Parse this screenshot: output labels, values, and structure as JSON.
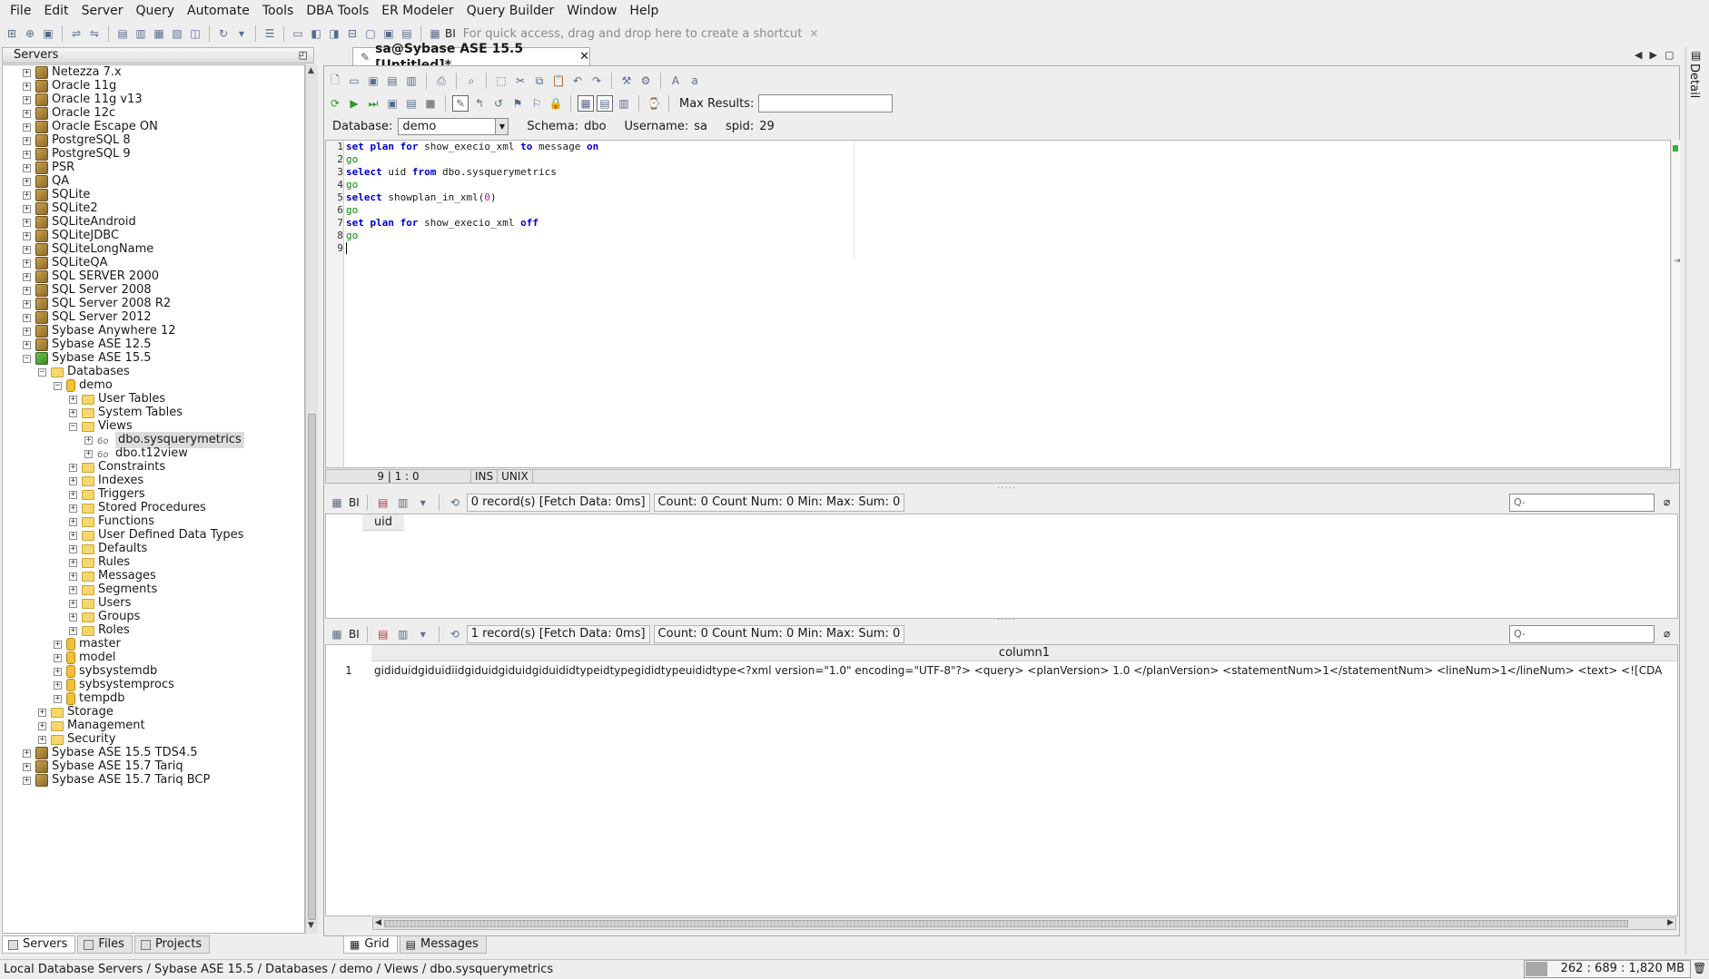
{
  "menu": [
    "File",
    "Edit",
    "Server",
    "Query",
    "Automate",
    "Tools",
    "DBA Tools",
    "ER Modeler",
    "Query Builder",
    "Window",
    "Help"
  ],
  "toolbar": {
    "bi_label": "BI",
    "shortcut_hint": "For quick access, drag and drop here to create a shortcut"
  },
  "servers_panel": {
    "title": "Servers",
    "tree": [
      {
        "label": "Netezza 7.x",
        "level": 0,
        "toggle": "+",
        "icon": "db"
      },
      {
        "label": "Oracle 11g",
        "level": 0,
        "toggle": "+",
        "icon": "db"
      },
      {
        "label": "Oracle 11g v13",
        "level": 0,
        "toggle": "+",
        "icon": "db"
      },
      {
        "label": "Oracle 12c",
        "level": 0,
        "toggle": "+",
        "icon": "db"
      },
      {
        "label": "Oracle Escape ON",
        "level": 0,
        "toggle": "+",
        "icon": "db"
      },
      {
        "label": "PostgreSQL 8",
        "level": 0,
        "toggle": "+",
        "icon": "db"
      },
      {
        "label": "PostgreSQL 9",
        "level": 0,
        "toggle": "+",
        "icon": "db"
      },
      {
        "label": "PSR",
        "level": 0,
        "toggle": "+",
        "icon": "db"
      },
      {
        "label": "QA",
        "level": 0,
        "toggle": "+",
        "icon": "db"
      },
      {
        "label": "SQLite",
        "level": 0,
        "toggle": "+",
        "icon": "db"
      },
      {
        "label": "SQLite2",
        "level": 0,
        "toggle": "+",
        "icon": "db"
      },
      {
        "label": "SQLiteAndroid",
        "level": 0,
        "toggle": "+",
        "icon": "db"
      },
      {
        "label": "SQLiteJDBC",
        "level": 0,
        "toggle": "+",
        "icon": "db"
      },
      {
        "label": "SQLiteLongName",
        "level": 0,
        "toggle": "+",
        "icon": "db"
      },
      {
        "label": "SQLiteQA",
        "level": 0,
        "toggle": "+",
        "icon": "db"
      },
      {
        "label": "SQL SERVER 2000",
        "level": 0,
        "toggle": "+",
        "icon": "db"
      },
      {
        "label": "SQL Server 2008",
        "level": 0,
        "toggle": "+",
        "icon": "db"
      },
      {
        "label": "SQL Server 2008 R2",
        "level": 0,
        "toggle": "+",
        "icon": "db"
      },
      {
        "label": "SQL Server 2012",
        "level": 0,
        "toggle": "+",
        "icon": "db"
      },
      {
        "label": "Sybase Anywhere 12",
        "level": 0,
        "toggle": "+",
        "icon": "db"
      },
      {
        "label": "Sybase ASE 12.5",
        "level": 0,
        "toggle": "+",
        "icon": "db"
      },
      {
        "label": "Sybase ASE 15.5",
        "level": 0,
        "toggle": "-",
        "icon": "db-on"
      },
      {
        "label": "Databases",
        "level": 1,
        "toggle": "-",
        "icon": "folder"
      },
      {
        "label": "demo",
        "level": 2,
        "toggle": "-",
        "icon": "cyl"
      },
      {
        "label": "User Tables",
        "level": 3,
        "toggle": "+",
        "icon": "folder"
      },
      {
        "label": "System Tables",
        "level": 3,
        "toggle": "+",
        "icon": "folder"
      },
      {
        "label": "Views",
        "level": 3,
        "toggle": "-",
        "icon": "folder"
      },
      {
        "label": "dbo.sysquerymetrics",
        "level": 4,
        "toggle": "+",
        "icon": "view",
        "selected": true
      },
      {
        "label": "dbo.t12view",
        "level": 4,
        "toggle": "+",
        "icon": "view"
      },
      {
        "label": "Constraints",
        "level": 3,
        "toggle": "+",
        "icon": "folder"
      },
      {
        "label": "Indexes",
        "level": 3,
        "toggle": "+",
        "icon": "folder"
      },
      {
        "label": "Triggers",
        "level": 3,
        "toggle": "+",
        "icon": "folder"
      },
      {
        "label": "Stored Procedures",
        "level": 3,
        "toggle": "+",
        "icon": "folder"
      },
      {
        "label": "Functions",
        "level": 3,
        "toggle": "+",
        "icon": "folder"
      },
      {
        "label": "User Defined Data Types",
        "level": 3,
        "toggle": "+",
        "icon": "folder"
      },
      {
        "label": "Defaults",
        "level": 3,
        "toggle": "+",
        "icon": "folder"
      },
      {
        "label": "Rules",
        "level": 3,
        "toggle": "+",
        "icon": "folder"
      },
      {
        "label": "Messages",
        "level": 3,
        "toggle": "+",
        "icon": "folder"
      },
      {
        "label": "Segments",
        "level": 3,
        "toggle": "+",
        "icon": "folder"
      },
      {
        "label": "Users",
        "level": 3,
        "toggle": "+",
        "icon": "folder"
      },
      {
        "label": "Groups",
        "level": 3,
        "toggle": "+",
        "icon": "folder"
      },
      {
        "label": "Roles",
        "level": 3,
        "toggle": "+",
        "icon": "folder"
      },
      {
        "label": "master",
        "level": 2,
        "toggle": "+",
        "icon": "cyl"
      },
      {
        "label": "model",
        "level": 2,
        "toggle": "+",
        "icon": "cyl"
      },
      {
        "label": "sybsystemdb",
        "level": 2,
        "toggle": "+",
        "icon": "cyl"
      },
      {
        "label": "sybsystemprocs",
        "level": 2,
        "toggle": "+",
        "icon": "cyl"
      },
      {
        "label": "tempdb",
        "level": 2,
        "toggle": "+",
        "icon": "cyl"
      },
      {
        "label": "Storage",
        "level": 1,
        "toggle": "+",
        "icon": "folder"
      },
      {
        "label": "Management",
        "level": 1,
        "toggle": "+",
        "icon": "folder"
      },
      {
        "label": "Security",
        "level": 1,
        "toggle": "+",
        "icon": "folder"
      },
      {
        "label": "Sybase ASE 15.5 TDS4.5",
        "level": 0,
        "toggle": "+",
        "icon": "db"
      },
      {
        "label": "Sybase ASE 15.7 Tariq",
        "level": 0,
        "toggle": "+",
        "icon": "db"
      },
      {
        "label": "Sybase ASE 15.7 Tariq BCP",
        "level": 0,
        "toggle": "+",
        "icon": "db"
      }
    ],
    "tabs": [
      "Servers",
      "Files",
      "Projects"
    ]
  },
  "editor": {
    "tab_title": "sa@Sybase ASE 15.5 [Untitled]*",
    "max_results_label": "Max Results:",
    "max_results_value": "",
    "database_label": "Database:",
    "database_value": "demo",
    "schema_label": "Schema:",
    "schema_value": "dbo",
    "username_label": "Username:",
    "username_value": "sa",
    "spid_label": "spid:",
    "spid_value": "29",
    "line_numbers": [
      "1",
      "2",
      "3",
      "4",
      "5",
      "6",
      "7",
      "8",
      "9"
    ],
    "status": {
      "position": "9 | 1 : 0",
      "mode": "INS",
      "eol": "UNIX"
    }
  },
  "result1": {
    "bi_label": "BI",
    "records": "0 record(s) [Fetch Data: 0ms]",
    "stats": "Count: 0   Count Num: 0   Min:    Max:    Sum: 0",
    "search_placeholder": "Q-",
    "column": "uid"
  },
  "result2": {
    "bi_label": "BI",
    "records": "1 record(s) [Fetch Data: 0ms]",
    "stats": "Count: 0   Count Num: 0   Min:    Max:    Sum: 0",
    "search_placeholder": "Q-",
    "column": "column1",
    "row_number": "1",
    "cell": "gididuidgiduidiidgiduidgiduidgiduididtypeidtypegididtypeuididtype<?xml version=\"1.0\" encoding=\"UTF-8\"?> <query> <planVersion> 1.0 </planVersion> <statementNum>1</statementNum> <lineNum>1</lineNum> <text> <![CDA"
  },
  "bottom_tabs": [
    "Grid",
    "Messages"
  ],
  "detail_label": "Detail",
  "statusbar": {
    "path": "Local Database Servers / Sybase ASE 15.5 / Databases / demo / Views / dbo.sysquerymetrics",
    "memory": "262 : 689 : 1,820 MB"
  },
  "colors": {
    "keyword": "#0000c8",
    "go": "#008a00",
    "number": "#9a2a9a",
    "active_server": "#3a8c2a"
  }
}
